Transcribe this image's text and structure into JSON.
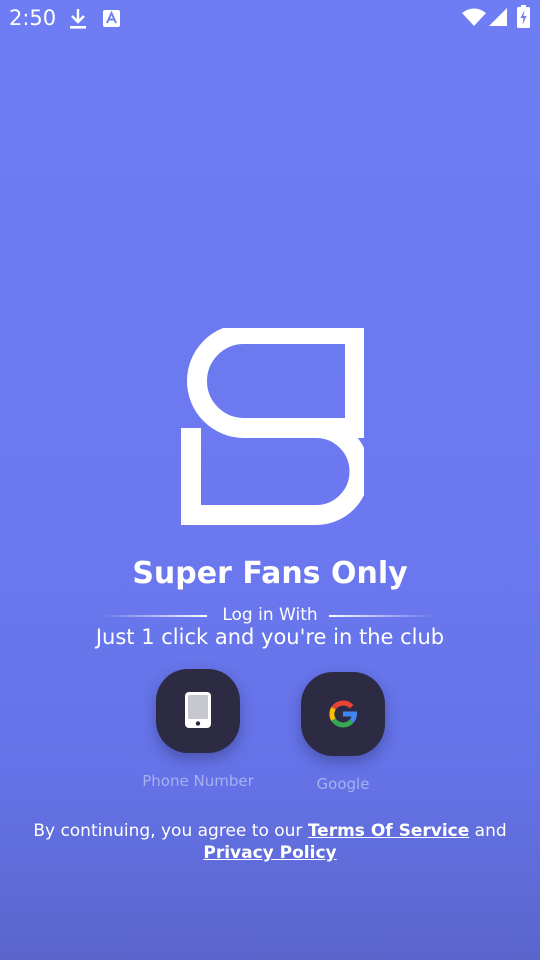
{
  "status_bar": {
    "time": "2:50",
    "icons": [
      "download-icon",
      "font-app-icon",
      "wifi-icon",
      "signal-icon",
      "battery-charging-icon"
    ]
  },
  "app": {
    "logo_icon": "superfans-s-logo-icon",
    "title": "Super Fans Only"
  },
  "login": {
    "heading": "Log in With",
    "tagline": "Just 1 click and you're in the club",
    "options": [
      {
        "label": "Phone Number",
        "icon": "phone-icon"
      },
      {
        "label": "Google",
        "icon": "google-icon"
      }
    ]
  },
  "legal": {
    "prefix": "By continuing, you agree to our ",
    "terms_link": "Terms Of Service",
    "conjunction": " and",
    "privacy_link": "Privacy Policy"
  },
  "colors": {
    "background_top": "#6e7df3",
    "background_bottom": "#5a65cc",
    "button_bg": "#2d2b44",
    "label_muted": "#a7b0f0"
  }
}
